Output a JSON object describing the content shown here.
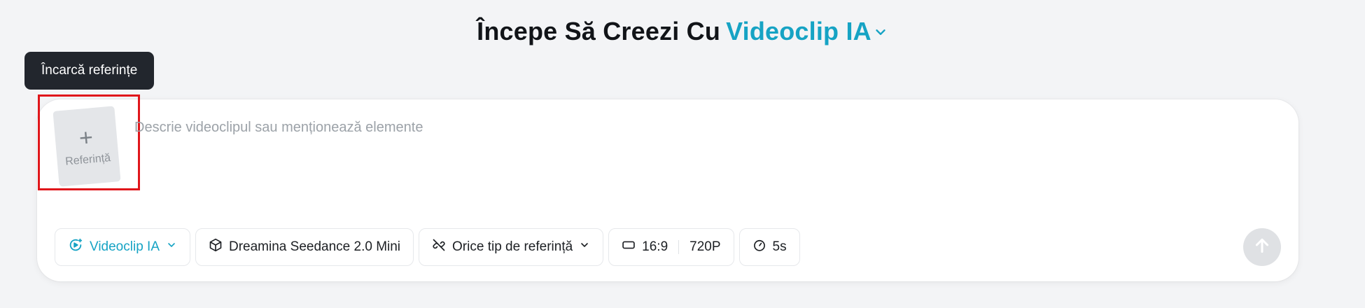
{
  "header": {
    "title_prefix": "Începe Să Creezi Cu",
    "title_accent": "Videoclip IA",
    "accent_color": "#16a3c4"
  },
  "tooltip": {
    "text": "Încarcă referințe"
  },
  "reference_tile": {
    "label": "Referință"
  },
  "prompt": {
    "placeholder": "Descrie videoclipul sau menționează elemente",
    "value": ""
  },
  "toolbar": {
    "mode_label": "Videoclip IA",
    "model_label": "Dreamina Seedance 2.0 Mini",
    "reference_type_label": "Orice tip de referință",
    "aspect_ratio": "16:9",
    "resolution": "720P",
    "duration": "5s"
  },
  "icons": {
    "mode": "video-sparkle-icon",
    "model": "cube-icon",
    "reference_type": "link-off-icon",
    "aspect": "rectangle-icon",
    "duration": "timer-icon",
    "send": "arrow-up-icon"
  },
  "colors": {
    "background": "#f3f4f6",
    "tooltip_bg": "#22262d",
    "highlight": "#e0161b",
    "send_disabled": "#dfe1e4"
  }
}
